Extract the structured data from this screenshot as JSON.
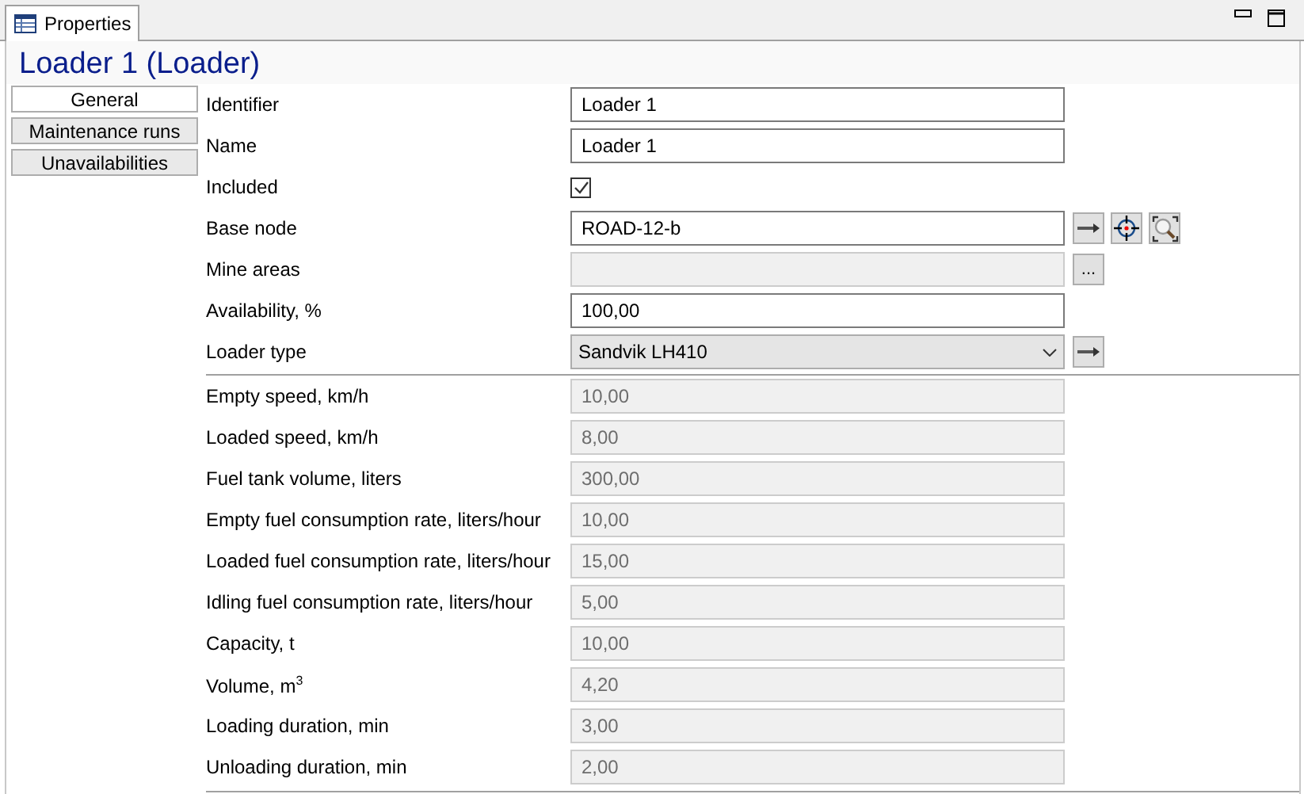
{
  "tab": {
    "title": "Properties",
    "selected": true
  },
  "title": "Loader 1 (Loader)",
  "sections": [
    {
      "label": "General",
      "selected": true
    },
    {
      "label": "Maintenance runs",
      "selected": false
    },
    {
      "label": "Unavailabilities",
      "selected": false
    }
  ],
  "main_fields": [
    {
      "kind": "text",
      "label": "Identifier",
      "value": "Loader 1"
    },
    {
      "kind": "text",
      "label": "Name",
      "value": "Loader 1"
    },
    {
      "kind": "checkbox",
      "label": "Included",
      "checked": true
    },
    {
      "kind": "text",
      "label": "Base node",
      "value": "ROAD-12-b",
      "buttons": [
        {
          "kind": "arrow"
        },
        {
          "kind": "target"
        },
        {
          "kind": "zoom"
        }
      ]
    },
    {
      "kind": "text",
      "label": "Mine areas",
      "disabled": true,
      "buttons": [
        {
          "kind": "text",
          "label": "..."
        }
      ]
    },
    {
      "kind": "text",
      "label": "Availability, %",
      "value": "100,00"
    },
    {
      "kind": "dropdown",
      "label": "Loader type",
      "value": "Sandvik LH410",
      "buttons": [
        {
          "kind": "arrow"
        }
      ]
    }
  ],
  "derived_fields": [
    {
      "kind": "text",
      "label": "Empty speed, km/h",
      "value": "10,00",
      "disabled": true
    },
    {
      "kind": "text",
      "label": "Loaded speed, km/h",
      "value": "8,00",
      "disabled": true
    },
    {
      "kind": "text",
      "label": "Fuel tank volume, liters",
      "value": "300,00",
      "disabled": true
    },
    {
      "kind": "text",
      "label": "Empty fuel consumption rate, liters/hour",
      "value": "10,00",
      "disabled": true
    },
    {
      "kind": "text",
      "label": "Loaded fuel consumption rate, liters/hour",
      "value": "15,00",
      "disabled": true
    },
    {
      "kind": "text",
      "label": "Idling fuel consumption rate, liters/hour",
      "value": "5,00",
      "disabled": true
    },
    {
      "kind": "text",
      "label": "Capacity, t",
      "value": "10,00",
      "disabled": true
    },
    {
      "kind": "text",
      "label": "Volume, m$^{3}$",
      "value": "4,20",
      "disabled": true
    },
    {
      "kind": "text",
      "label": "Loading duration, min",
      "value": "3,00",
      "disabled": true
    },
    {
      "kind": "text",
      "label": "Unloading duration, min",
      "value": "2,00",
      "disabled": true
    }
  ]
}
